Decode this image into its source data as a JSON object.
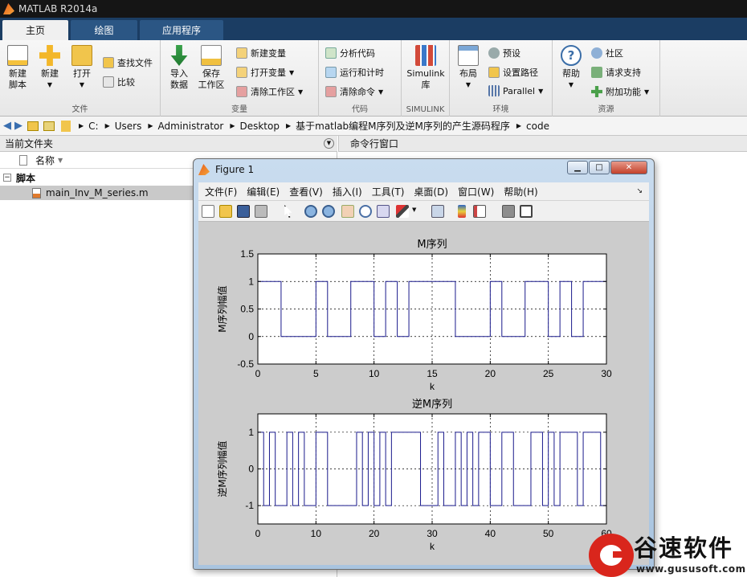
{
  "window": {
    "title": "MATLAB R2014a"
  },
  "tabs": [
    "主页",
    "绘图",
    "应用程序"
  ],
  "ribbon": {
    "file": {
      "new_script": "新建\n脚本",
      "new": "新建",
      "open": "打开",
      "find_files": "查找文件",
      "compare": "比较",
      "label": "文件"
    },
    "variable": {
      "import": "导入\n数据",
      "save_ws": "保存\n工作区",
      "new_var": "新建变量",
      "open_var": "打开变量",
      "clear_ws": "清除工作区",
      "label": "变量"
    },
    "code": {
      "analyze": "分析代码",
      "run_time": "运行和计时",
      "clear_cmd": "清除命令",
      "label": "代码"
    },
    "simulink": {
      "lib": "Simulink\n库",
      "label": "SIMULINK"
    },
    "env": {
      "layout": "布局",
      "prefs": "预设",
      "set_path": "设置路径",
      "parallel": "Parallel",
      "label": "环境"
    },
    "resources": {
      "help": "帮助",
      "community": "社区",
      "support": "请求支持",
      "addons": "附加功能",
      "label": "资源"
    }
  },
  "address": {
    "segments": [
      "C:",
      "Users",
      "Administrator",
      "Desktop",
      "基于matlab编程M序列及逆M序列的产生源码程序",
      "code"
    ]
  },
  "left_panel": {
    "title": "当前文件夹",
    "col_name": "名称",
    "group": "脚本",
    "file": "main_Inv_M_series.m"
  },
  "cmd_panel": {
    "title": "命令行窗口"
  },
  "figure": {
    "title": "Figure 1",
    "menu": [
      "文件(F)",
      "编辑(E)",
      "查看(V)",
      "插入(I)",
      "工具(T)",
      "桌面(D)",
      "窗口(W)",
      "帮助(H)"
    ]
  },
  "watermark": {
    "brand": "谷速软件",
    "url": "www.gususoft.com"
  },
  "colors": {
    "line": "#1a1a8c",
    "titlebar": "#151515",
    "tabs": "#1b3d63"
  },
  "chart_data": [
    {
      "type": "line",
      "title": "M序列",
      "xlabel": "k",
      "ylabel": "M序列幅值",
      "xlim": [
        0,
        30
      ],
      "ylim": [
        -0.5,
        1.5
      ],
      "xticks": [
        0,
        5,
        10,
        15,
        20,
        25,
        30
      ],
      "yticks": [
        -0.5,
        0,
        0.5,
        1,
        1.5
      ],
      "grid": true,
      "series": [
        {
          "values": [
            1,
            1,
            0,
            0,
            0,
            1,
            0,
            0,
            1,
            1,
            0,
            1,
            0,
            1,
            1,
            1,
            1,
            0,
            0,
            0,
            1,
            0,
            0,
            1,
            1,
            0,
            1,
            0,
            1,
            1
          ]
        }
      ]
    },
    {
      "type": "line",
      "title": "逆M序列",
      "xlabel": "k",
      "ylabel": "逆M序列幅值",
      "xlim": [
        0,
        60
      ],
      "ylim": [
        -1.5,
        1.5
      ],
      "xticks": [
        0,
        10,
        20,
        30,
        40,
        50,
        60
      ],
      "yticks": [
        -1,
        0,
        1
      ],
      "grid": true,
      "series": [
        {
          "values": [
            1,
            -1,
            1,
            -1,
            -1,
            1,
            -1,
            1,
            -1,
            -1,
            1,
            1,
            -1,
            -1,
            -1,
            -1,
            -1,
            1,
            -1,
            1,
            -1,
            1,
            -1,
            1,
            1,
            1,
            1,
            1,
            -1,
            -1,
            -1,
            1,
            -1,
            -1,
            1,
            -1,
            1,
            -1,
            1,
            1,
            -1,
            -1,
            1,
            1,
            -1,
            -1,
            -1,
            1,
            1,
            -1,
            1,
            -1,
            1,
            1,
            1,
            -1,
            1,
            1,
            1,
            -1
          ]
        }
      ]
    }
  ]
}
